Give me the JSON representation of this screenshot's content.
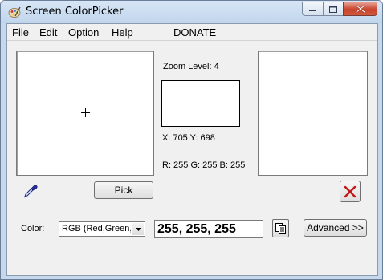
{
  "window": {
    "title": "Screen ColorPicker",
    "app_icon": "color-palette-icon"
  },
  "titlebar_buttons": {
    "minimize_icon": "minimize-icon",
    "maximize_icon": "maximize-icon",
    "close_icon": "close-icon"
  },
  "menu": {
    "items": [
      "File",
      "Edit",
      "Option",
      "Help"
    ],
    "donate": "DONATE"
  },
  "zoom": {
    "label": "Zoom Level: 4"
  },
  "coordinates": {
    "text": "X: 705 Y: 698"
  },
  "rgb_readout": {
    "text": "R: 255 G: 255 B: 255"
  },
  "buttons": {
    "pick": "Pick",
    "advanced": "Advanced >>",
    "eyedropper_icon": "eyedropper-icon",
    "clear_icon": "red-x-icon",
    "copy_icon": "copy-clipboard-icon"
  },
  "color_row": {
    "label": "Color:",
    "format_selected": "RGB (Red,Green,Blue)",
    "value": "255, 255, 255"
  },
  "colors": {
    "picked_color": "#ffffff",
    "titlebar": "#c6d8ec",
    "close_button": "#c8432c"
  }
}
